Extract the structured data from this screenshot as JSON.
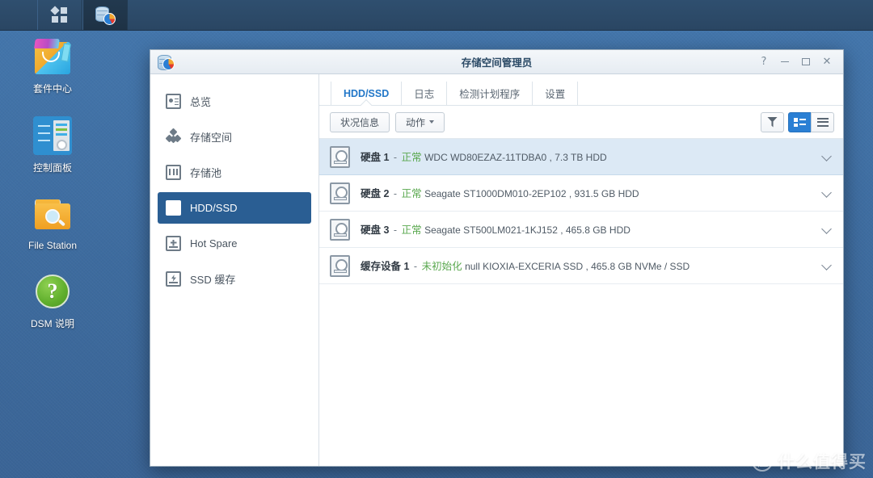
{
  "taskbar": {
    "menu_button_label": "main-menu",
    "apps": [
      {
        "name": "storage-manager",
        "title": "存储空间管理员",
        "active": true
      }
    ]
  },
  "desktop": {
    "icons": [
      {
        "id": "package-center",
        "label": "套件中心"
      },
      {
        "id": "control-panel",
        "label": "控制面板"
      },
      {
        "id": "file-station",
        "label": "File Station"
      },
      {
        "id": "dsm-help",
        "label": "DSM 说明",
        "glyph": "?"
      }
    ]
  },
  "window": {
    "title": "存储空间管理员",
    "controls": {
      "help": "?",
      "minimize": "−",
      "maximize": "□",
      "close": "✕"
    }
  },
  "sidebar": {
    "items": [
      {
        "label": "总览",
        "icon": "overview-icon",
        "active": false
      },
      {
        "label": "存储空间",
        "icon": "volume-icon",
        "active": false
      },
      {
        "label": "存储池",
        "icon": "pool-icon",
        "active": false
      },
      {
        "label": "HDD/SSD",
        "icon": "hdd-icon",
        "active": true
      },
      {
        "label": "Hot Spare",
        "icon": "hotspare-icon",
        "active": false
      },
      {
        "label": "SSD 缓存",
        "icon": "ssd-cache-icon",
        "active": false
      }
    ]
  },
  "tabs": [
    {
      "label": "HDD/SSD",
      "active": true
    },
    {
      "label": "日志",
      "active": false
    },
    {
      "label": "检测计划程序",
      "active": false
    },
    {
      "label": "设置",
      "active": false
    }
  ],
  "toolbar": {
    "health_info_label": "状况信息",
    "action_label": "动作",
    "icons": [
      {
        "name": "filter-icon",
        "active": false
      },
      {
        "name": "list-detail-icon",
        "active": true
      },
      {
        "name": "list-compact-icon",
        "active": false
      }
    ]
  },
  "disks": [
    {
      "name": "硬盘 1",
      "separator": "-",
      "status": "正常",
      "details": "WDC WD80EZAZ-11TDBA0 , 7.3 TB HDD",
      "selected": true
    },
    {
      "name": "硬盘 2",
      "separator": "-",
      "status": "正常",
      "details": "Seagate ST1000DM010-2EP102 , 931.5 GB HDD",
      "selected": false
    },
    {
      "name": "硬盘 3",
      "separator": "-",
      "status": "正常",
      "details": "Seagate ST500LM021-1KJ152 , 465.8 GB HDD",
      "selected": false
    },
    {
      "name": "缓存设备 1",
      "separator": "-",
      "status": "未初始化",
      "details": "null KIOXIA-EXCERIA SSD , 465.8 GB NVMe / SSD",
      "selected": false
    }
  ],
  "watermark": {
    "badge": "值",
    "text": "什么值得买"
  },
  "colors": {
    "accent": "#2a7fd4",
    "sidebar_active": "#2a5e93",
    "status_ok": "#5aa84f",
    "row_selected": "#dce9f5",
    "desktop": "#3d6b9e"
  }
}
